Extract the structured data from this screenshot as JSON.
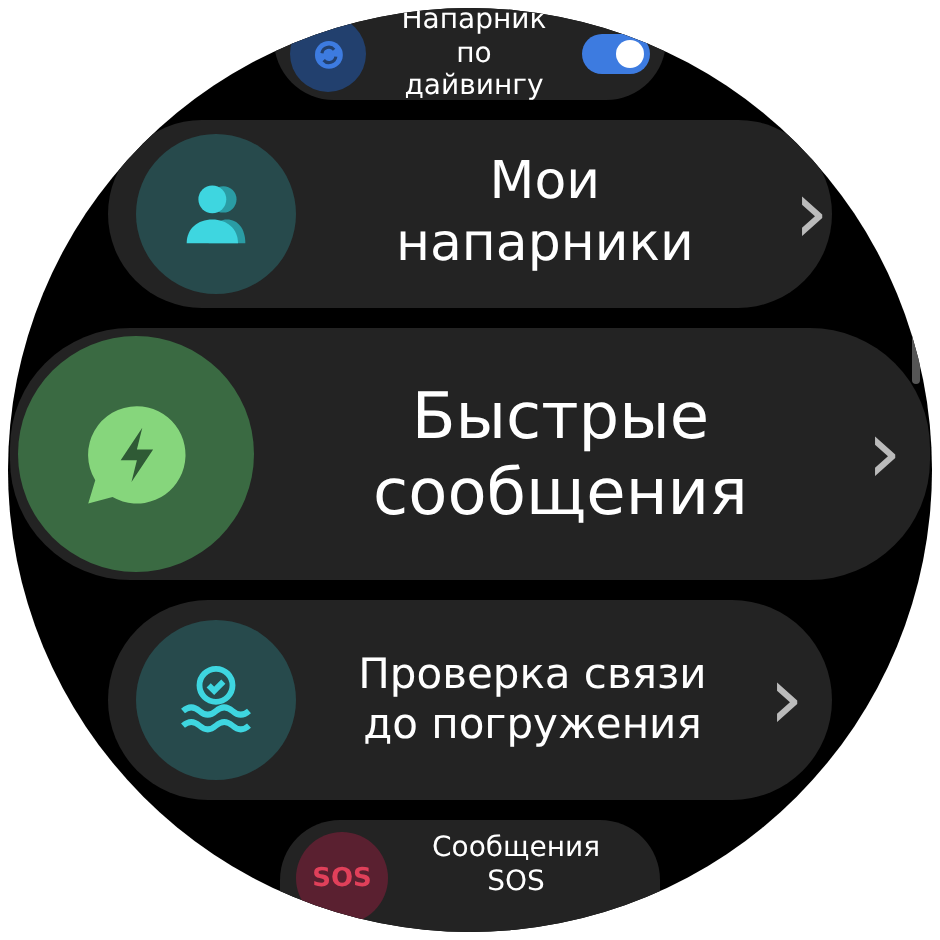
{
  "items": [
    {
      "kind": "toggle",
      "label": "Напарник по дайвингу",
      "on": true
    },
    {
      "kind": "link",
      "label": "Мои напарники",
      "chevron": "›"
    },
    {
      "kind": "link",
      "label": "Быстрые сообщения",
      "chevron": "›"
    },
    {
      "kind": "link",
      "label": "Проверка связи до погружения",
      "chevron": "›"
    },
    {
      "kind": "link",
      "label": "Сообщения SOS",
      "icon_text": "SOS"
    }
  ]
}
